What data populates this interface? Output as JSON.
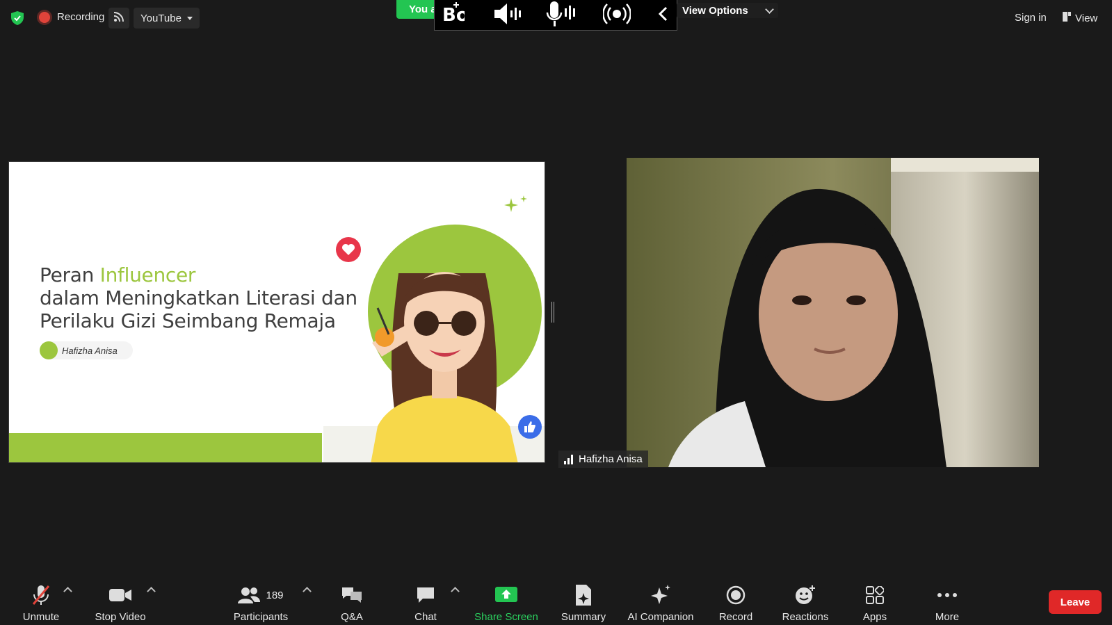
{
  "top_bar": {
    "recording_label": "Recording",
    "stream_platform": "YouTube",
    "you_are_pill": "You a",
    "view_options_label": "View Options",
    "sign_in_label": "Sign in",
    "view_label": "View"
  },
  "slide": {
    "title_word1": "Peran",
    "title_highlight": "Influencer",
    "title_line2": "dalam Meningkatkan Literasi dan",
    "title_line3": "Perilaku Gizi Seimbang Remaja",
    "author": "Hafizha Anisa"
  },
  "participant_video": {
    "name": "Hafizha Anisa"
  },
  "toolbar": {
    "unmute": "Unmute",
    "stop_video": "Stop Video",
    "participant_count": "189",
    "participants": "Participants",
    "qa": "Q&A",
    "chat": "Chat",
    "share_screen": "Share Screen",
    "summary": "Summary",
    "ai_companion": "AI Companion",
    "record": "Record",
    "reactions": "Reactions",
    "apps": "Apps",
    "more": "More",
    "leave": "Leave"
  },
  "colors": {
    "share_green": "#23c552",
    "leave_red": "#e02828",
    "slide_accent": "#9cc63e"
  }
}
